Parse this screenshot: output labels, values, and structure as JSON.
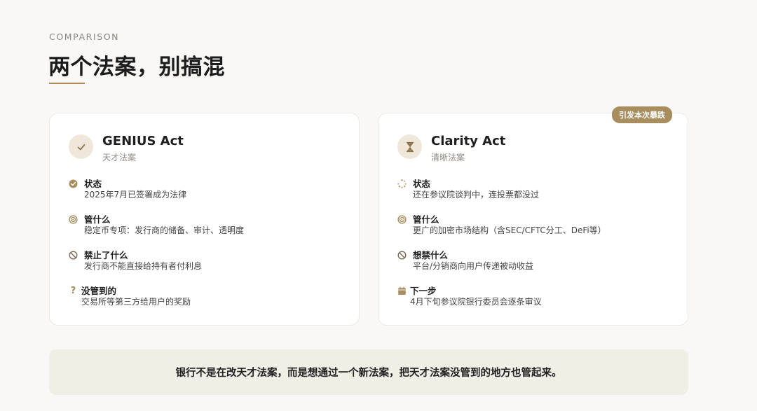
{
  "header": {
    "eyebrow": "COMPARISON",
    "title": "两个法案，别搞混"
  },
  "cards": [
    {
      "title": "GENIUS Act",
      "subtitle": "天才法案",
      "icon": "check-icon",
      "items": [
        {
          "icon": "check-circle-icon",
          "label": "状态",
          "text": "2025年7月已签署成为法律"
        },
        {
          "icon": "target-icon",
          "label": "管什么",
          "text": "稳定币专项：发行商的储备、审计、透明度"
        },
        {
          "icon": "ban-icon",
          "label": "禁止了什么",
          "text": "发行商不能直接给持有者付利息"
        },
        {
          "icon": "question-icon",
          "label": "没管到的",
          "text": "交易所等第三方给用户的奖励"
        }
      ]
    },
    {
      "title": "Clarity Act",
      "subtitle": "清晰法案",
      "icon": "hourglass-icon",
      "badge": "引发本次暴跌",
      "items": [
        {
          "icon": "spinner-icon",
          "label": "状态",
          "text": "还在参议院谈判中，连投票都没过"
        },
        {
          "icon": "target-icon",
          "label": "管什么",
          "text": "更广的加密市场结构（含SEC/CFTC分工、DeFi等）"
        },
        {
          "icon": "ban-icon",
          "label": "想禁什么",
          "text": "平台/分销商向用户传递被动收益"
        },
        {
          "icon": "calendar-icon",
          "label": "下一步",
          "text": "4月下旬参议院银行委员会逐条审议"
        }
      ]
    }
  ],
  "banner": {
    "text": "银行不是在改天才法案，而是想通过一个新法案，把天才法案没管到的地方也管起来。"
  },
  "colors": {
    "accent": "#a88d5e",
    "background": "#faf8f6",
    "card": "#ffffff",
    "banner": "#f1eee6"
  }
}
